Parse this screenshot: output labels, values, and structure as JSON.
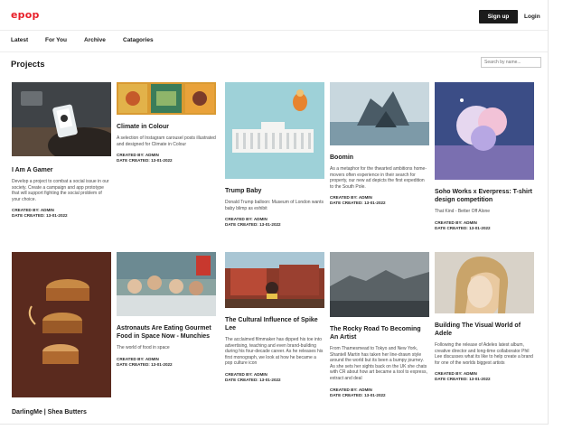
{
  "brand": {
    "logo": "epop",
    "accent": "#e8202a"
  },
  "header": {
    "signup_label": "Sign up",
    "login_label": "Login"
  },
  "nav": {
    "items": [
      "Latest",
      "For You",
      "Archive",
      "Catagories"
    ]
  },
  "page": {
    "title": "Projects",
    "search_placeholder": "Search by name..."
  },
  "cards": [
    {
      "title": "I Am A Gamer",
      "desc": "Develop a project to combat a social issue in our society. Create a campaign and app prototype that will support fighting the social problem of your choice.",
      "created_by": "CREATED BY: ADMIN",
      "date": "DATE CREATED: 13-01-2022"
    },
    {
      "title": "Climate in Colour",
      "desc": "A selection of Instagram carousel posts illustrated and designed for Climate in Colour",
      "created_by": "CREATED BY: ADMIN",
      "date": "DATE CREATED: 13-01-2022"
    },
    {
      "title": "Trump Baby",
      "desc": "Donald Trump balloon: Museum of London wants baby blimp as exhibit",
      "created_by": "CREATED BY: ADMIN",
      "date": "DATE CREATED: 13-01-2022"
    },
    {
      "title": "Boomin",
      "desc": "As a metaphor for the thwarted ambitions home-movers often experience in their search for property, our new ad depicts the first expedition to the South Pole.",
      "created_by": "CREATED BY: ADMIN",
      "date": "DATE CREATED: 13-01-2022"
    },
    {
      "title": "Soho Works x Everpress: T-shirt design competition",
      "desc": "That Kind - Better Off Alone",
      "created_by": "CREATED BY: ADMIN",
      "date": "DATE CREATED: 13-01-2022"
    },
    {
      "title": "DarlingMe | Shea Butters",
      "desc": "",
      "created_by": "",
      "date": ""
    },
    {
      "title": "Astronauts Are Eating Gourmet Food in Space Now - Munchies",
      "desc": "The world of food in space",
      "created_by": "CREATED BY: ADMIN",
      "date": "DATE CREATED: 13-01-2022"
    },
    {
      "title": "The Cultural Influence of Spike Lee",
      "desc": "The acclaimed filmmaker has dipped his toe into advertising, teaching and even brand-building during his four-decade career. As he releases his first monograph, we look at how he became a pop culture icon",
      "created_by": "CREATED BY: ADMIN",
      "date": "DATE CREATED: 13-01-2022"
    },
    {
      "title": "The Rocky Road To Becoming An Artist",
      "desc": "From Thamesmead to Tokyo and New York, Shantell Martin has taken her line-drawn style around the world but its been a bumpy journey. As she sets her sights back on the UK she chats with CR about how art became a tool to express, extract and deal",
      "created_by": "CREATED BY: ADMIN",
      "date": "DATE CREATED: 13-01-2022"
    },
    {
      "title": "Building The Visual World of Adele",
      "desc": "Following the release of Adeles latest album, creative director and long-time collaborator Phil Lee discusses what its like to help create a brand for one of the worlds biggest artists",
      "created_by": "CREATED BY: ADMIN",
      "date": "DATE CREATED: 13-01-2022"
    }
  ]
}
